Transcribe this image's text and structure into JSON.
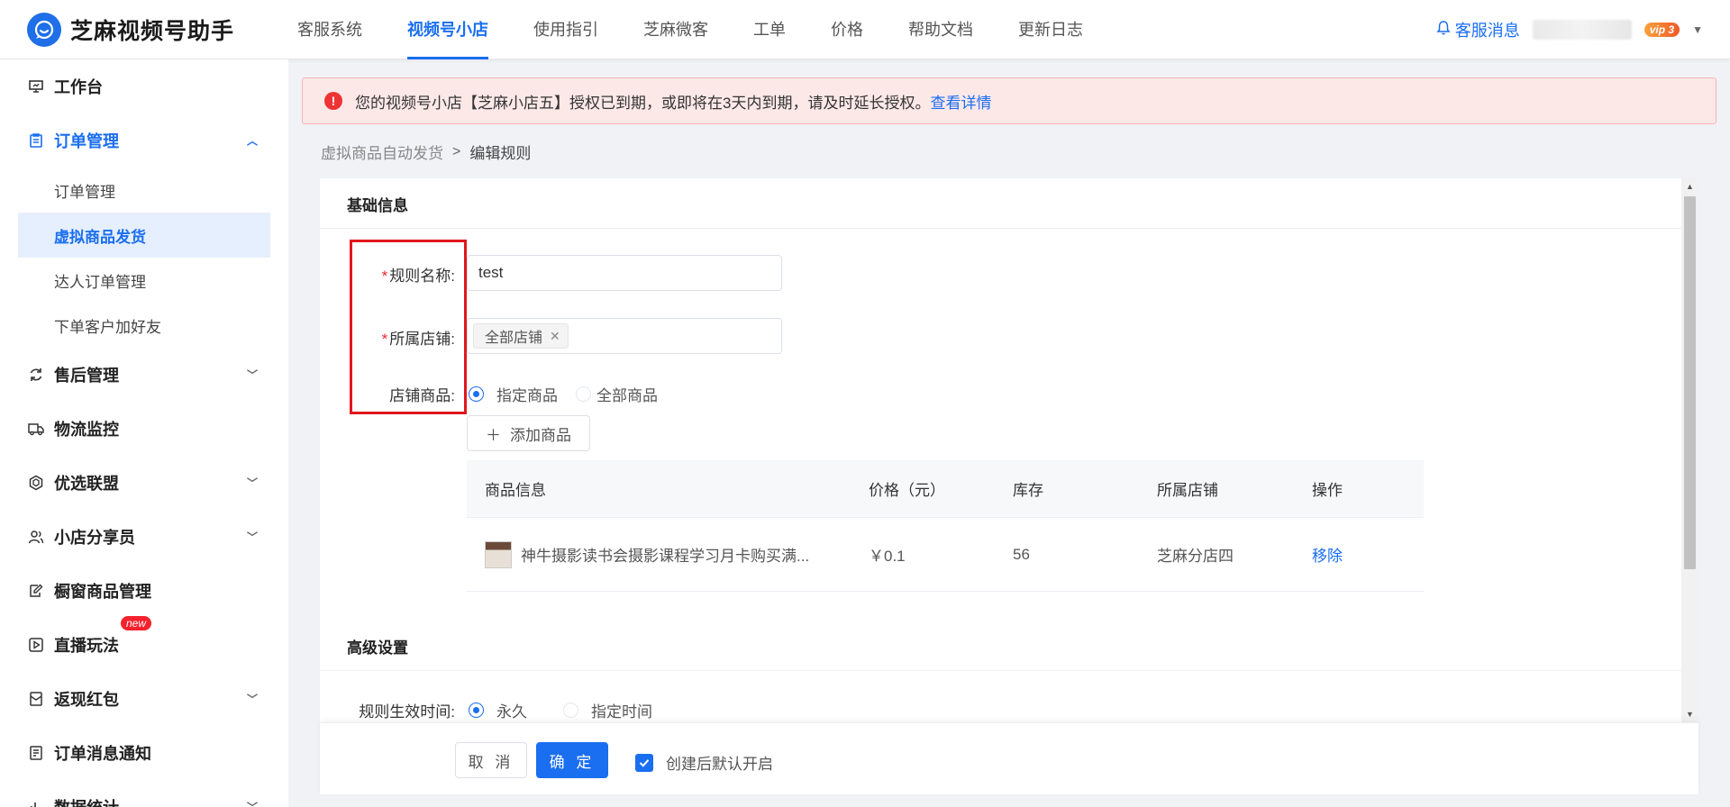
{
  "app": {
    "title": "芝麻视频号助手"
  },
  "nav": {
    "items": [
      "客服系统",
      "视频号小店",
      "使用指引",
      "芝麻微客",
      "工单",
      "价格",
      "帮助文档",
      "更新日志"
    ],
    "active_index": 1
  },
  "header_right": {
    "cs_message": "客服消息",
    "vip_badge": "vip 3"
  },
  "sidebar": {
    "items": [
      {
        "label": "工作台",
        "icon": "monitor-icon"
      },
      {
        "label": "订单管理",
        "icon": "clipboard-icon",
        "expanded": true
      },
      {
        "label": "售后管理",
        "icon": "refresh-icon"
      },
      {
        "label": "物流监控",
        "icon": "truck-icon"
      },
      {
        "label": "优选联盟",
        "icon": "hexagon-icon"
      },
      {
        "label": "小店分享员",
        "icon": "users-icon"
      },
      {
        "label": "橱窗商品管理",
        "icon": "edit-icon"
      },
      {
        "label": "直播玩法",
        "icon": "play-icon",
        "badge": "new"
      },
      {
        "label": "返现红包",
        "icon": "redpacket-icon"
      },
      {
        "label": "订单消息通知",
        "icon": "notice-icon"
      },
      {
        "label": "数据统计",
        "icon": "chart-icon"
      }
    ],
    "order_sub_items": [
      "订单管理",
      "虚拟商品发货",
      "达人订单管理",
      "下单客户加好友"
    ],
    "active_sub_index": 1
  },
  "alert": {
    "text": "您的视频号小店【芝麻小店五】授权已到期，或即将在3天内到期，请及时延长授权。",
    "link": "查看详情"
  },
  "breadcrumb": {
    "parent": "虚拟商品自动发货",
    "current": "编辑规则"
  },
  "basic": {
    "section_title": "基础信息",
    "rule_name_label": "规则名称:",
    "rule_name_value": "test",
    "store_label": "所属店铺:",
    "store_tag": "全部店铺",
    "products_label": "店铺商品:",
    "product_options": [
      "指定商品",
      "全部商品"
    ],
    "product_selected": 0,
    "add_button": "添加商品"
  },
  "table": {
    "headers": [
      "商品信息",
      "价格（元）",
      "库存",
      "所属店铺",
      "操作"
    ],
    "rows": [
      {
        "name": "神牛摄影读书会摄影课程学习月卡购买满...",
        "price": "￥0.1",
        "stock": "56",
        "store": "芝麻分店四",
        "action": "移除"
      }
    ]
  },
  "advanced": {
    "section_title": "高级设置",
    "effective_label": "规则生效时间:",
    "effective_options": [
      "永久",
      "指定时间"
    ],
    "effective_selected": 0
  },
  "footer": {
    "cancel": "取 消",
    "confirm": "确 定",
    "default_on_label": "创建后默认开启",
    "default_on_checked": true
  },
  "colors": {
    "primary": "#1a6ef0",
    "alert_bg": "#fde8e8",
    "danger": "#e0171d"
  }
}
